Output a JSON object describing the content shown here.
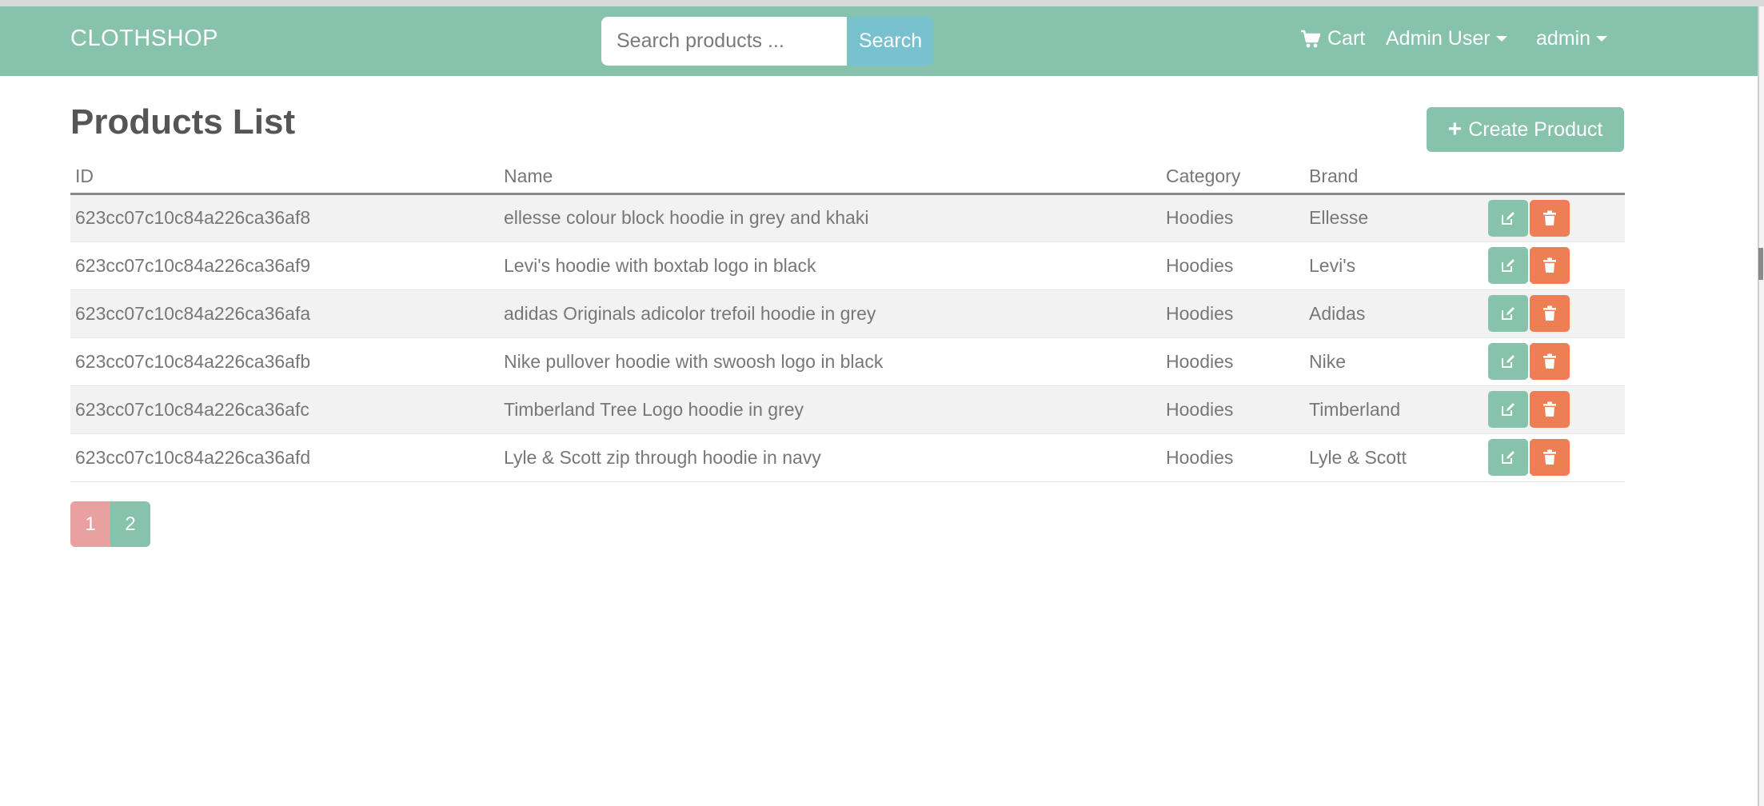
{
  "navbar": {
    "brand": "CLOTHSHOP",
    "search_placeholder": "Search products ...",
    "search_button": "Search",
    "cart_label": "Cart",
    "cart_icon": "shopping-cart-icon",
    "user_menu_label": "Admin User",
    "admin_menu_label": "admin"
  },
  "main": {
    "title": "Products List",
    "create_button": "Create Product",
    "create_icon": "plus-icon"
  },
  "table": {
    "headers": [
      "ID",
      "Name",
      "Category",
      "Brand"
    ],
    "rows": [
      {
        "id": "623cc07c10c84a226ca36af8",
        "name": "ellesse colour block hoodie in grey and khaki",
        "category": "Hoodies",
        "brand": "Ellesse"
      },
      {
        "id": "623cc07c10c84a226ca36af9",
        "name": "Levi's hoodie with boxtab logo in black",
        "category": "Hoodies",
        "brand": "Levi's"
      },
      {
        "id": "623cc07c10c84a226ca36afa",
        "name": "adidas Originals adicolor trefoil hoodie in grey",
        "category": "Hoodies",
        "brand": "Adidas"
      },
      {
        "id": "623cc07c10c84a226ca36afb",
        "name": "Nike pullover hoodie with swoosh logo in black",
        "category": "Hoodies",
        "brand": "Nike"
      },
      {
        "id": "623cc07c10c84a226ca36afc",
        "name": "Timberland Tree Logo hoodie in grey",
        "category": "Hoodies",
        "brand": "Timberland"
      },
      {
        "id": "623cc07c10c84a226ca36afd",
        "name": "Lyle & Scott zip through hoodie in navy",
        "category": "Hoodies",
        "brand": "Lyle & Scott"
      }
    ],
    "edit_icon": "edit-icon",
    "delete_icon": "trash-icon"
  },
  "pagination": {
    "pages": [
      "1",
      "2"
    ],
    "active_page": "1"
  },
  "colors": {
    "primary": "#87c2ad",
    "info": "#78c2d0",
    "danger": "#ee7f54",
    "active_page": "#e8a0a1"
  }
}
